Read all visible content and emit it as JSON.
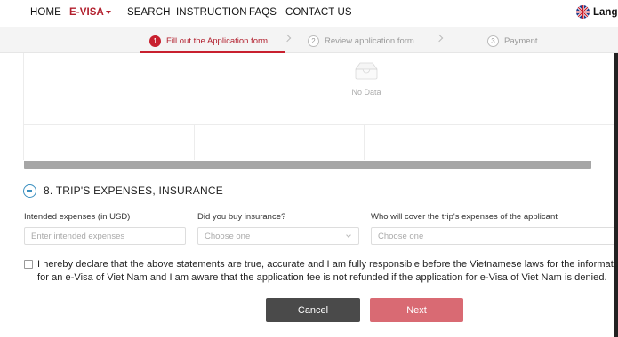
{
  "nav": {
    "items": [
      "HOME",
      "E-VISA",
      "SEARCH",
      "INSTRUCTION",
      "FAQS",
      "CONTACT US"
    ],
    "language_label": "Langu",
    "brand_color": "#b21f2d"
  },
  "stepper": {
    "steps": [
      {
        "num": "1",
        "label": "Fill out the Application form",
        "active": true
      },
      {
        "num": "2",
        "label": "Review application form",
        "active": false
      },
      {
        "num": "3",
        "label": "Payment",
        "active": false
      }
    ]
  },
  "table": {
    "empty_text": "No Data"
  },
  "section": {
    "title": "8. TRIP'S EXPENSES, INSURANCE",
    "fields": [
      {
        "label": "Intended expenses (in USD)",
        "placeholder": "Enter intended expenses",
        "type": "input"
      },
      {
        "label": "Did you buy insurance?",
        "placeholder": "Choose one",
        "type": "select"
      },
      {
        "label": "Who will cover the trip's expenses of the applicant",
        "placeholder": "Choose one",
        "type": "select"
      }
    ]
  },
  "declaration": {
    "line1": "I hereby declare that the above statements are true, accurate and I am fully responsible before the Vietnamese laws for the information",
    "line2": "for an e-Visa of Viet Nam and I am aware that the application fee is not refunded if the application for e-Visa of Viet Nam is denied."
  },
  "buttons": {
    "cancel": "Cancel",
    "next": "Next"
  }
}
